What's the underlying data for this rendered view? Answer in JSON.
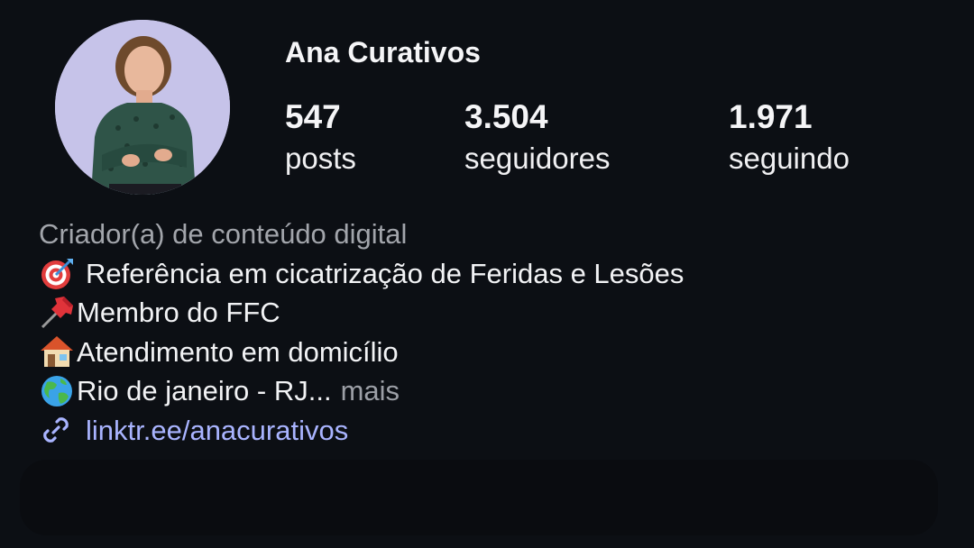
{
  "profile": {
    "name": "Ana Curativos",
    "avatar_icon": "profile-photo"
  },
  "stats": {
    "posts": {
      "value": "547",
      "label": "posts"
    },
    "followers": {
      "value": "3.504",
      "label": "seguidores"
    },
    "following": {
      "value": "1.971",
      "label": "seguindo"
    }
  },
  "bio": {
    "category": "Criador(a) de conteúdo digital",
    "lines": [
      {
        "icon": "target-icon",
        "text": "Referência em cicatrização de Feridas e Lesões"
      },
      {
        "icon": "pushpin-icon",
        "text": "Membro do FFC"
      },
      {
        "icon": "house-icon",
        "text": "Atendimento em domicílio"
      },
      {
        "icon": "globe-icon",
        "text": "Rio de janeiro - RJ..."
      }
    ],
    "more_label": "mais",
    "link": {
      "icon": "link-icon",
      "text": "linktr.ee/anacurativos",
      "color": "#a9b4ff"
    }
  },
  "colors": {
    "background": "#0c0f14",
    "avatar_bg": "#c6c3e9",
    "muted_text": "#a2a5ab"
  }
}
